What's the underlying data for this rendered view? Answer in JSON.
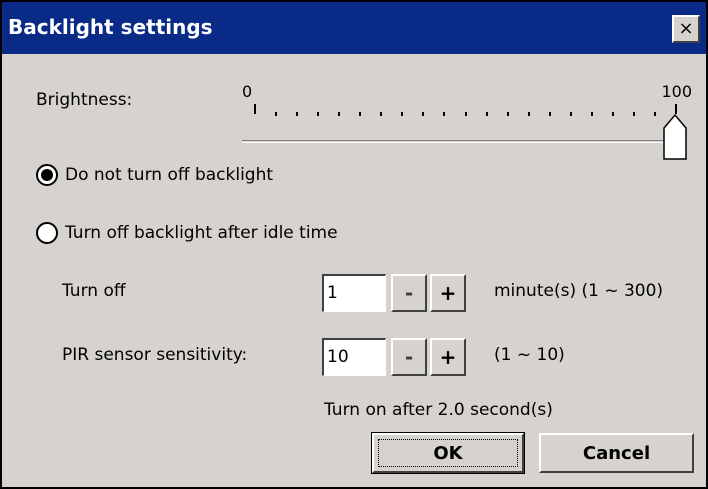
{
  "window": {
    "title": "Backlight settings",
    "close_glyph": "×",
    "colors": {
      "titlebar": "#0a2a87",
      "face": "#d6d3ce"
    }
  },
  "brightness": {
    "label": "Brightness:",
    "min_label": "0",
    "max_label": "100",
    "value": 100,
    "min": 0,
    "max": 100
  },
  "backlight_mode": {
    "selected": "never",
    "options": [
      {
        "id": "never",
        "label": "Do not turn off backlight",
        "checked": true
      },
      {
        "id": "idle",
        "label": "Turn off backlight after idle time",
        "checked": false
      }
    ]
  },
  "turn_off": {
    "label": "Turn off",
    "value": "1",
    "minus": "-",
    "plus": "+",
    "range_text": "minute(s) (1 ~ 300)"
  },
  "pir": {
    "label": "PIR sensor sensitivity:",
    "value": "10",
    "minus": "-",
    "plus": "+",
    "range_text": "(1 ~ 10)"
  },
  "turn_on_text": "Turn on after 2.0 second(s)",
  "buttons": {
    "ok": "OK",
    "cancel": "Cancel"
  }
}
